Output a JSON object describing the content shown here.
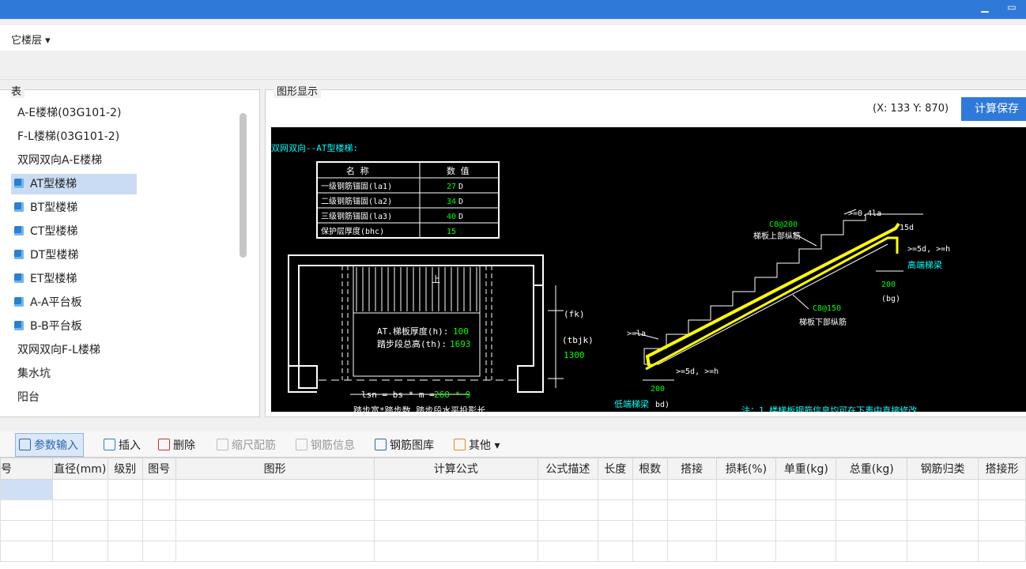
{
  "floor_selector": {
    "label": "它楼层 ▾"
  },
  "tree": {
    "group_title": "表",
    "items": [
      {
        "label": "A-E楼梯(03G101-2)",
        "icon": false,
        "selected": false
      },
      {
        "label": "F-L楼梯(03G101-2)",
        "icon": false,
        "selected": false
      },
      {
        "label": "双网双向A-E楼梯",
        "icon": false,
        "selected": false
      },
      {
        "label": "AT型楼梯",
        "icon": true,
        "selected": true
      },
      {
        "label": "BT型楼梯",
        "icon": true,
        "selected": false
      },
      {
        "label": "CT型楼梯",
        "icon": true,
        "selected": false
      },
      {
        "label": "DT型楼梯",
        "icon": true,
        "selected": false
      },
      {
        "label": "ET型楼梯",
        "icon": true,
        "selected": false
      },
      {
        "label": "A-A平台板",
        "icon": true,
        "selected": false
      },
      {
        "label": "B-B平台板",
        "icon": true,
        "selected": false
      },
      {
        "label": "双网双向F-L楼梯",
        "icon": false,
        "selected": false
      },
      {
        "label": "集水坑",
        "icon": false,
        "selected": false
      },
      {
        "label": "阳台",
        "icon": false,
        "selected": false
      }
    ]
  },
  "graphic": {
    "group_title": "图形显示",
    "coords": "(X: 133 Y: 870)",
    "calc_save": "计算保存",
    "drawing": {
      "title": "双网双向--AT型楼梯:",
      "table_headers": [
        "名 称",
        "数 值"
      ],
      "table_rows": [
        {
          "name": "一级钢筋锚固(la1)",
          "value": "27",
          "unit": "D"
        },
        {
          "name": "二级钢筋锚固(la2)",
          "value": "34",
          "unit": "D"
        },
        {
          "name": "三级钢筋锚固(la3)",
          "value": "40",
          "unit": "D"
        },
        {
          "name": "保护层厚度(bhc)",
          "value": "15",
          "unit": ""
        }
      ],
      "plan": {
        "up": "上",
        "thick_label": "AT.梯板厚度(h):",
        "thick_value": "100",
        "total_label": "踏步段总高(th):",
        "total_value": "1693",
        "fk": "(fk)",
        "tbjk": "(tbjk)",
        "tbjk_value": "1300",
        "lsn_label": "lsn = bs * m =",
        "lsn_value": "260 * 9",
        "bottom_cut": "踏步宽*踏步数 踏步段水平投影长"
      },
      "section": {
        "top_anchor": ">=0.4la",
        "top_rebar": "C8@200",
        "top_rebar_desc": "梯板上部纵筋",
        "d15": "15d",
        "gt5d_top": ">=5d, >=h",
        "high_beam": "高端梯梁",
        "bg_value": "200",
        "bg": "(bg)",
        "bottom_rebar": "C8@150",
        "bottom_rebar_desc": "梯板下部纵筋",
        "la": ">=la",
        "gt5d_bottom": ">=5d, >=h",
        "bd_value": "200",
        "low_beam": "低端梯梁",
        "bd": "bd)",
        "note": "注：1.楼梯板钢筋信息均可在下表中直接修改"
      }
    }
  },
  "toolbar": {
    "param_input": "参数输入",
    "insert": "插入",
    "delete": "删除",
    "scale_rebar": "缩尺配筋",
    "rebar_info": "钢筋信息",
    "rebar_lib": "钢筋图库",
    "other": "其他 ▾"
  },
  "grid": {
    "columns": [
      "号",
      "直径(mm)",
      "级别",
      "图号",
      "图形",
      "计算公式",
      "公式描述",
      "长度",
      "根数",
      "搭接",
      "损耗(%)",
      "单重(kg)",
      "总重(kg)",
      "钢筋归类",
      "搭接形"
    ]
  },
  "colors": {
    "accent": "#2f7ad9",
    "selection": "#c9dcf3",
    "drawing_bg": "#000000",
    "cyan": "#00ffff",
    "yellow": "#ffff00",
    "green": "#00ff00"
  }
}
